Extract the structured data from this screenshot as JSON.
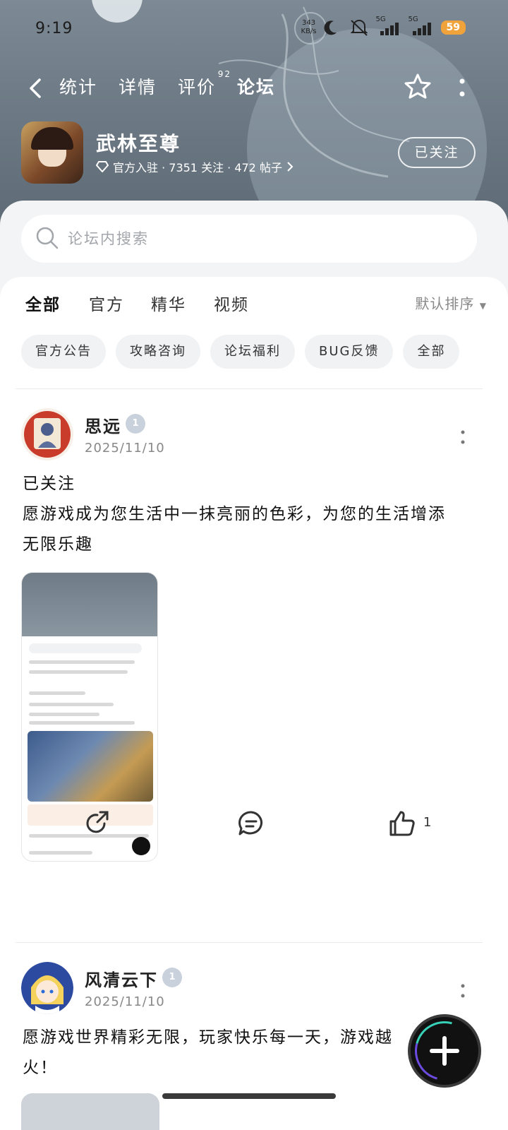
{
  "status": {
    "time": "9:19",
    "net_speed_value": "343",
    "net_speed_unit": "KB/s",
    "sig1": "5G",
    "sig2": "5G",
    "battery": "59"
  },
  "nav": {
    "tabs": [
      {
        "label": "统计"
      },
      {
        "label": "详情"
      },
      {
        "label": "评价",
        "badge": "92"
      },
      {
        "label": "论坛"
      }
    ],
    "active_tab": "论坛"
  },
  "game": {
    "name": "武林至尊",
    "meta": "官方入驻 · 7351 关注 · 472 帖子",
    "follow_label": "已关注"
  },
  "search": {
    "placeholder": "论坛内搜索"
  },
  "categories": {
    "items": [
      "全部",
      "官方",
      "精华",
      "视频"
    ],
    "active": "全部",
    "sort_label": "默认排序"
  },
  "chips": [
    "官方公告",
    "攻略咨询",
    "论坛福利",
    "BUG反馈",
    "全部"
  ],
  "posts": [
    {
      "user": "思远",
      "level": "1",
      "date": "2025/11/10",
      "text_lines": [
        "已关注",
        "愿游戏成为您生活中一抹亮丽的色彩，为您的生活增添",
        "无限乐趣"
      ],
      "like_count": "1"
    },
    {
      "user": "风清云下",
      "level": "1",
      "date": "2025/11/10",
      "text_lines": [
        "愿游戏世界精彩无限，玩家快乐每一天，游戏越",
        "火！"
      ]
    }
  ],
  "colors": {
    "accent": "#3cc7b3",
    "header_bg": "#6f7c87",
    "battery": "#f1a33b"
  }
}
